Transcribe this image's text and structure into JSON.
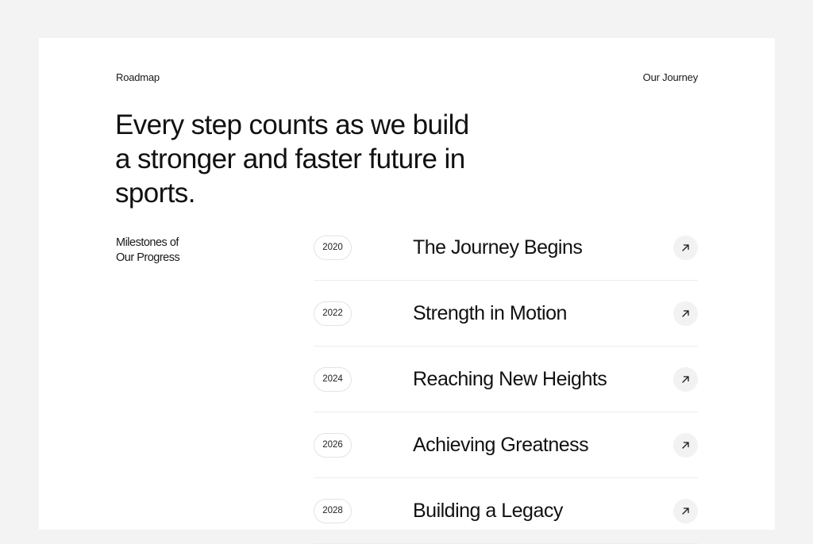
{
  "header": {
    "left_label": "Roadmap",
    "right_label": "Our Journey"
  },
  "hero": {
    "headline": "Every step counts as we build a stronger and faster future in sports."
  },
  "sidebar": {
    "label_line1": "Milestones of",
    "label_line2": "Our Progress"
  },
  "milestones": [
    {
      "year": "2020",
      "title": "The Journey Begins",
      "icon": "arrow-up-right-icon"
    },
    {
      "year": "2022",
      "title": "Strength in Motion",
      "icon": "arrow-up-right-icon"
    },
    {
      "year": "2024",
      "title": "Reaching New Heights",
      "icon": "arrow-up-right-icon"
    },
    {
      "year": "2026",
      "title": "Achieving Greatness",
      "icon": "arrow-up-right-icon"
    },
    {
      "year": "2028",
      "title": "Building a Legacy",
      "icon": "arrow-up-right-icon"
    }
  ],
  "colors": {
    "page_background": "#f3f3f3",
    "card_background": "#ffffff",
    "text": "#111111",
    "divider": "#ececec",
    "arrow_button_bg": "#f2f2f2"
  }
}
